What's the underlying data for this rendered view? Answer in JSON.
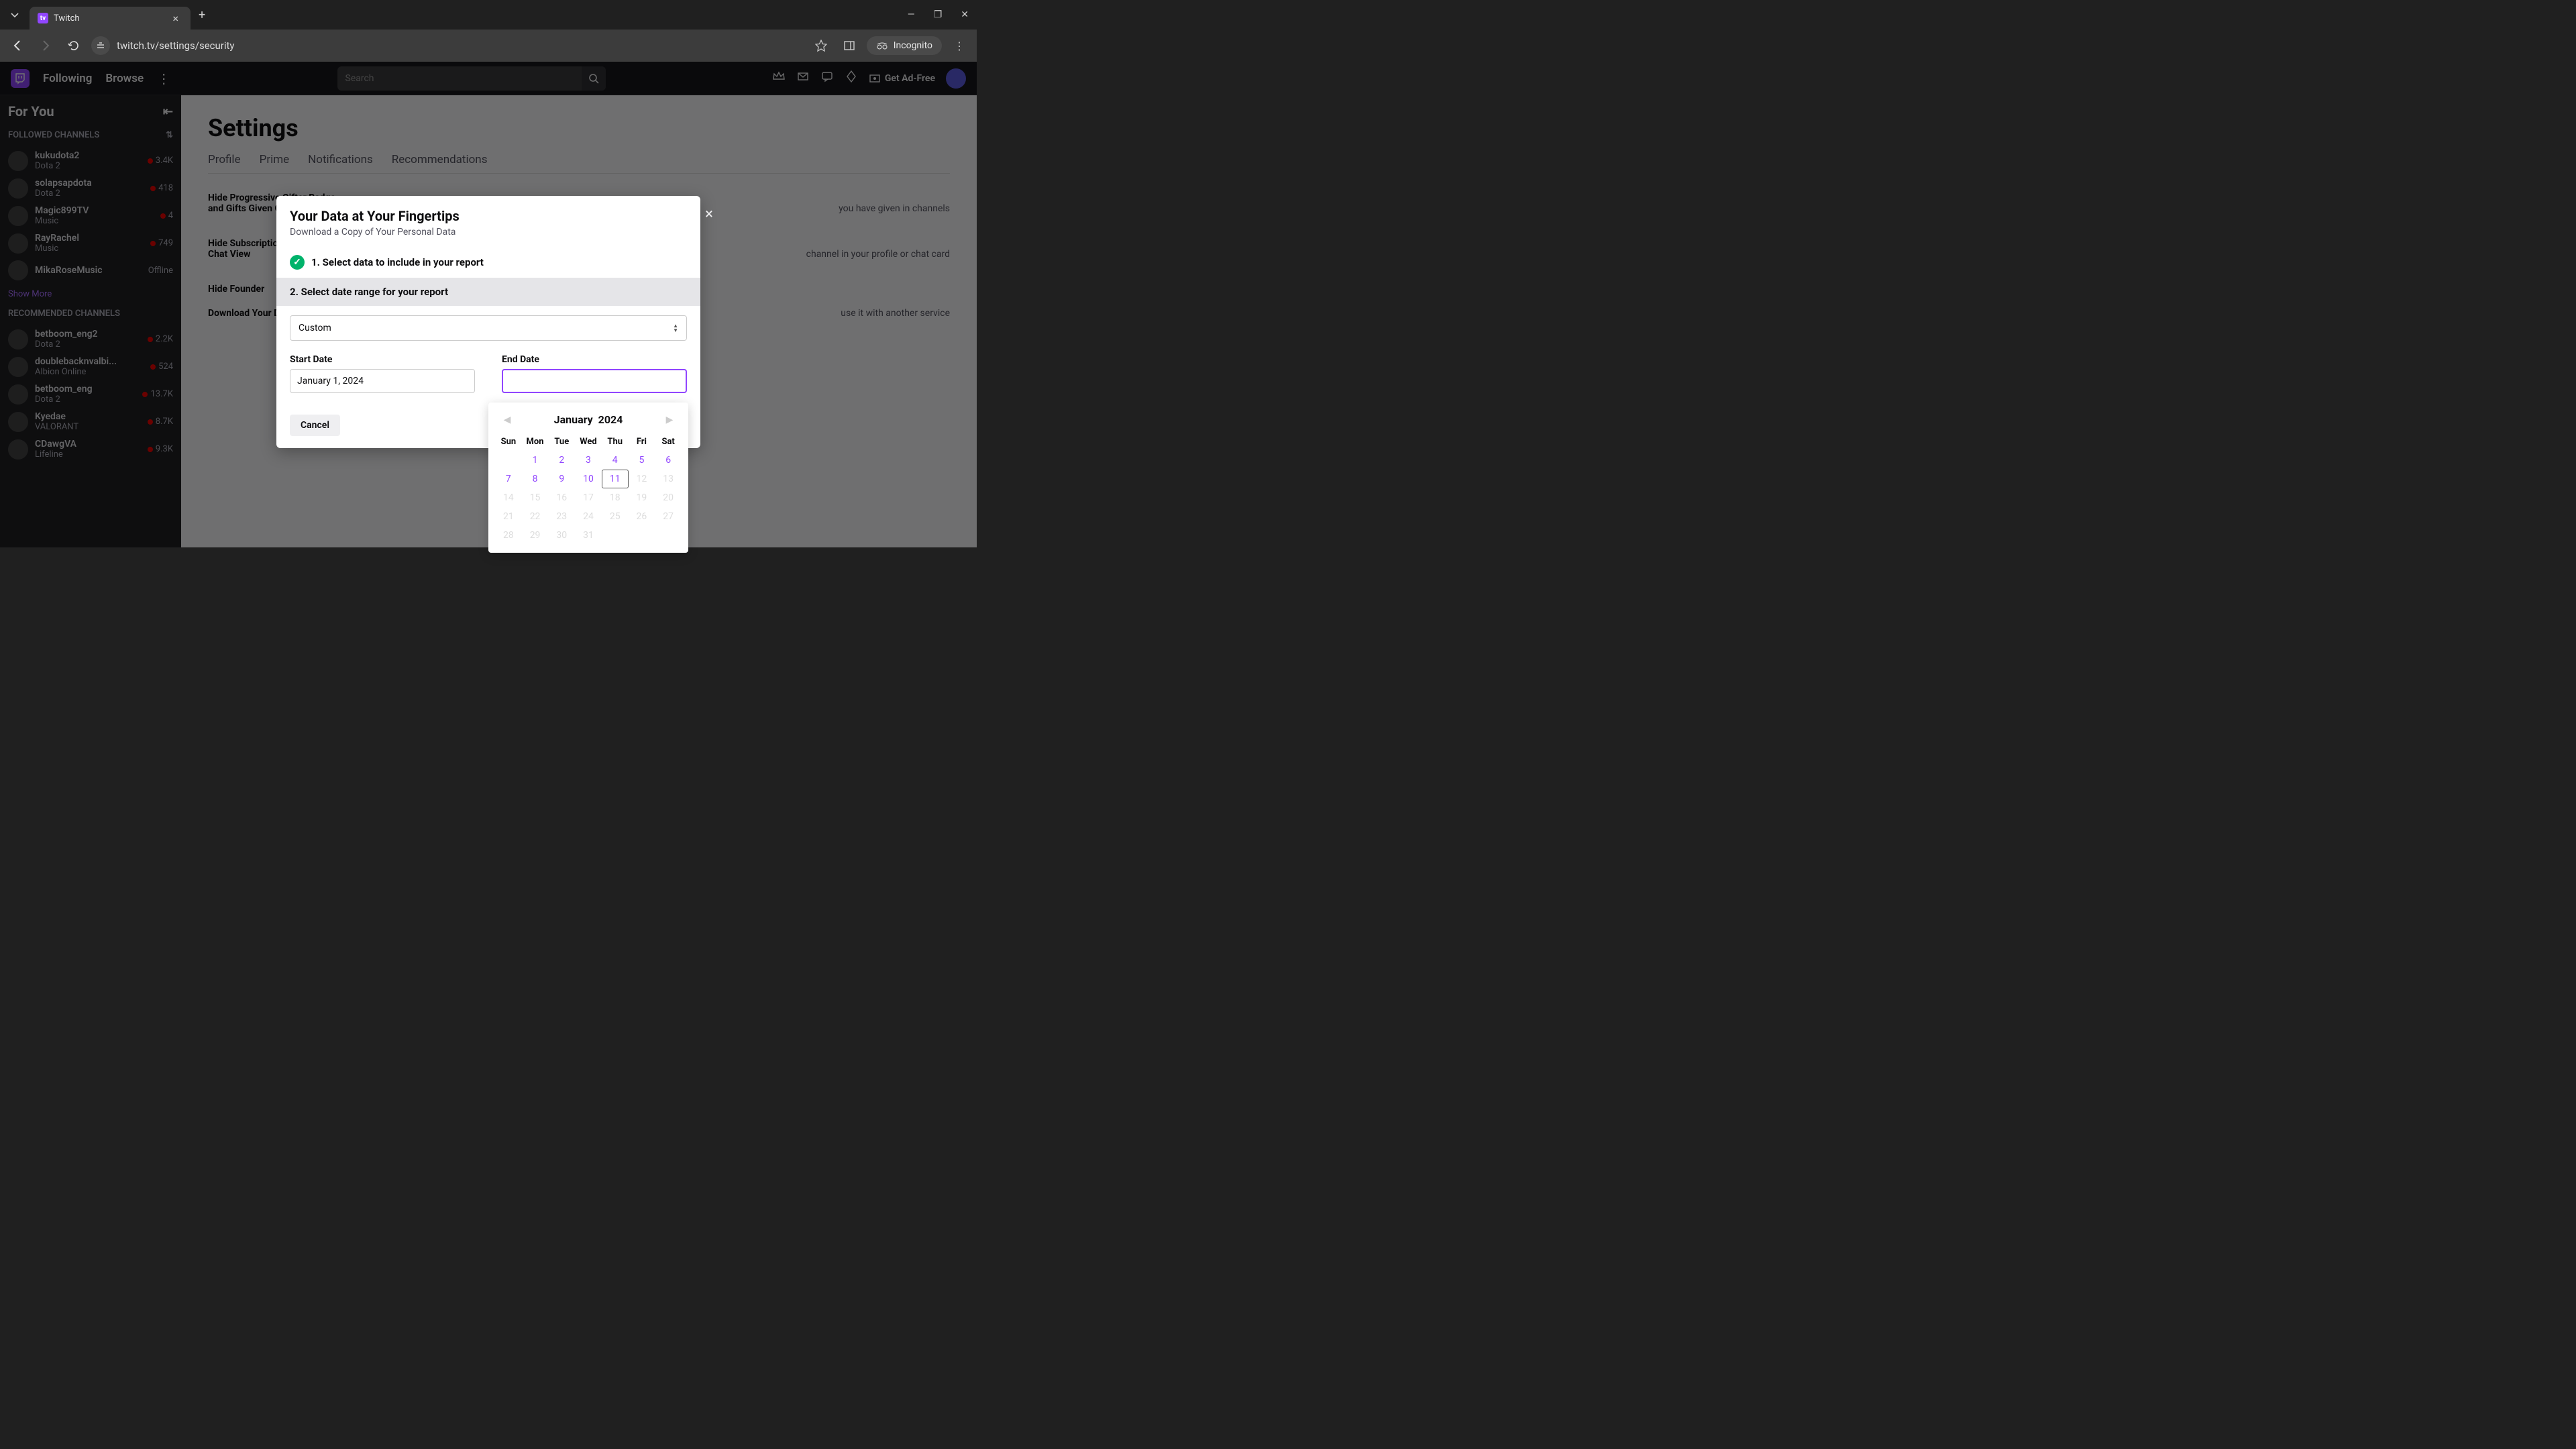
{
  "browser": {
    "tab_title": "Twitch",
    "url": "twitch.tv/settings/security",
    "incognito_label": "Incognito"
  },
  "twitch_header": {
    "nav_following": "Following",
    "nav_browse": "Browse",
    "search_placeholder": "Search",
    "ad_free": "Get Ad-Free"
  },
  "sidebar": {
    "for_you": "For You",
    "followed_label": "FOLLOWED CHANNELS",
    "recommended_label": "RECOMMENDED CHANNELS",
    "show_more": "Show More",
    "followed": [
      {
        "name": "kukudota2",
        "game": "Dota 2",
        "viewers": "3.4K",
        "live": true
      },
      {
        "name": "solapsapdota",
        "game": "Dota 2",
        "viewers": "418",
        "live": true
      },
      {
        "name": "Magic899TV",
        "game": "Music",
        "viewers": "4",
        "live": true
      },
      {
        "name": "RayRachel",
        "game": "Music",
        "viewers": "749",
        "live": true
      },
      {
        "name": "MikaRoseMusic",
        "game": "",
        "viewers": "Offline",
        "live": false
      }
    ],
    "recommended": [
      {
        "name": "betboom_eng2",
        "game": "Dota 2",
        "viewers": "2.2K",
        "live": true
      },
      {
        "name": "doublebacknvalbi...",
        "game": "Albion Online",
        "viewers": "524",
        "live": true
      },
      {
        "name": "betboom_eng",
        "game": "Dota 2",
        "viewers": "13.7K",
        "live": true
      },
      {
        "name": "Kyedae",
        "game": "VALORANT",
        "viewers": "8.7K",
        "live": true
      },
      {
        "name": "CDawgVA",
        "game": "Lifeline",
        "viewers": "9.3K",
        "live": true
      }
    ]
  },
  "main": {
    "title": "Settings",
    "tabs": [
      "Profile",
      "Prime",
      "Notifications",
      "Recommendations"
    ],
    "settings": [
      {
        "label": "Hide Progressive Gifter Badge and Gifts Given Count",
        "desc": "you have given in channels"
      },
      {
        "label": "Hide Subscription Status in Chat View",
        "desc": "channel in your profile or chat card"
      },
      {
        "label": "Hide Founder",
        "desc": ""
      },
      {
        "label": "Download Your Data",
        "desc": "use it with another service"
      }
    ]
  },
  "modal": {
    "title": "Your Data at Your Fingertips",
    "subtitle": "Download a Copy of Your Personal Data",
    "step1": "1. Select data to include in your report",
    "step2": "2. Select date range for your report",
    "range_value": "Custom",
    "start_label": "Start Date",
    "start_value": "January 1, 2024",
    "end_label": "End Date",
    "end_value": "",
    "cancel": "Cancel"
  },
  "calendar": {
    "month": "January",
    "year": "2024",
    "daynames": [
      "Sun",
      "Mon",
      "Tue",
      "Wed",
      "Thu",
      "Fri",
      "Sat"
    ],
    "leading_empty": 0,
    "days": [
      {
        "n": "",
        "state": "empty"
      },
      {
        "n": "1",
        "state": "enabled"
      },
      {
        "n": "2",
        "state": "enabled"
      },
      {
        "n": "3",
        "state": "enabled"
      },
      {
        "n": "4",
        "state": "enabled"
      },
      {
        "n": "5",
        "state": "enabled"
      },
      {
        "n": "6",
        "state": "enabled"
      },
      {
        "n": "7",
        "state": "enabled"
      },
      {
        "n": "8",
        "state": "enabled"
      },
      {
        "n": "9",
        "state": "enabled"
      },
      {
        "n": "10",
        "state": "enabled"
      },
      {
        "n": "11",
        "state": "hover"
      },
      {
        "n": "12",
        "state": "disabled"
      },
      {
        "n": "13",
        "state": "disabled"
      },
      {
        "n": "14",
        "state": "disabled"
      },
      {
        "n": "15",
        "state": "disabled"
      },
      {
        "n": "16",
        "state": "disabled"
      },
      {
        "n": "17",
        "state": "disabled"
      },
      {
        "n": "18",
        "state": "disabled"
      },
      {
        "n": "19",
        "state": "disabled"
      },
      {
        "n": "20",
        "state": "disabled"
      },
      {
        "n": "21",
        "state": "disabled"
      },
      {
        "n": "22",
        "state": "disabled"
      },
      {
        "n": "23",
        "state": "disabled"
      },
      {
        "n": "24",
        "state": "disabled"
      },
      {
        "n": "25",
        "state": "disabled"
      },
      {
        "n": "26",
        "state": "disabled"
      },
      {
        "n": "27",
        "state": "disabled"
      },
      {
        "n": "28",
        "state": "disabled"
      },
      {
        "n": "29",
        "state": "disabled"
      },
      {
        "n": "30",
        "state": "disabled"
      },
      {
        "n": "31",
        "state": "disabled"
      }
    ]
  }
}
